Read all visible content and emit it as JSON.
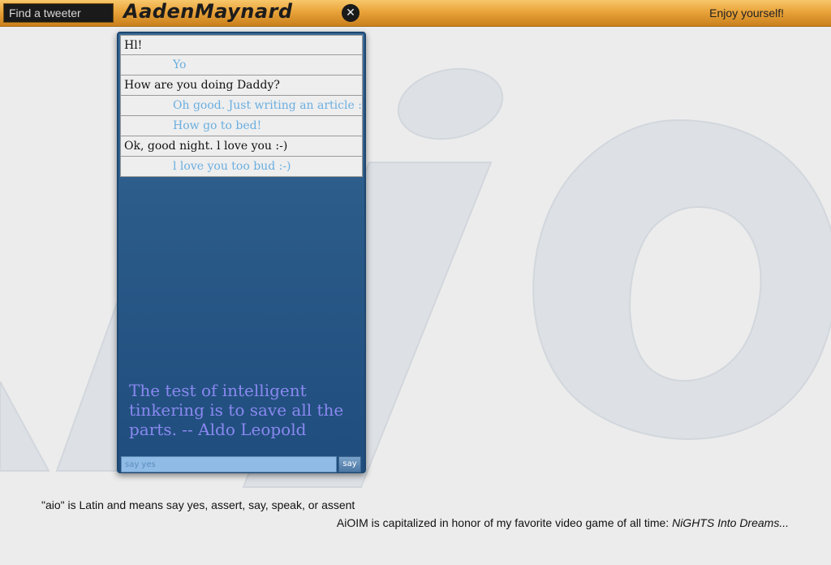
{
  "header": {
    "search_placeholder": "Find a tweeter",
    "username": "AadenMaynard",
    "close_glyph": "✕",
    "motto": "Enjoy yourself!"
  },
  "watermark": {
    "text": "aio",
    "color": "#dde1e6"
  },
  "chat": {
    "messages": [
      {
        "from": "them",
        "text": "Hl!"
      },
      {
        "from": "me",
        "text": "Yo"
      },
      {
        "from": "them",
        "text": "How are you doing Daddy?"
      },
      {
        "from": "me",
        "text": "Oh good. Just writing an article :-)"
      },
      {
        "from": "me",
        "text": "How go to bed!"
      },
      {
        "from": "them",
        "text": "Ok, good night. l love you :-)"
      },
      {
        "from": "me",
        "text": "l love you too bud :-)"
      }
    ],
    "quote": "The test of intelligent tinkering is to save all the parts. -- Aldo Leopold",
    "input_placeholder": "say yes",
    "say_label": "say"
  },
  "footer": {
    "line1": "\"aio\" is Latin and means say yes, assert, say, speak, or assent",
    "line2_prefix": "AiOIM is capitalized in honor of my favorite video game of all time: ",
    "line2_game": "NiGHTS Into Dreams..."
  },
  "colors": {
    "topbar": "#e9a33a",
    "panel": "#2b5b89",
    "my_message": "#6aaee0",
    "their_message": "#111111",
    "quote": "#8a88f0"
  }
}
